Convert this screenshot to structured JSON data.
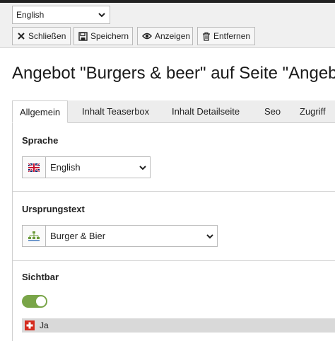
{
  "top": {
    "language_select": "English",
    "buttons": {
      "close": "Schließen",
      "save": "Speichern",
      "view": "Anzeigen",
      "delete": "Entfernen"
    }
  },
  "page_title": "Angebot \"Burgers & beer\" auf Seite \"Angebote",
  "tabs": [
    "Allgemein",
    "Inhalt Teaserbox",
    "Inhalt Detailseite",
    "Seo",
    "Zugriff"
  ],
  "fields": {
    "sprache": {
      "label": "Sprache",
      "value": "English",
      "icon": "uk-flag-icon"
    },
    "ursprungstext": {
      "label": "Ursprungstext",
      "value": "Burger & Bier",
      "icon": "sitemap-icon"
    },
    "sichtbar": {
      "label": "Sichtbar",
      "toggle_on": true,
      "status_text": "Ja",
      "status_icon": "swiss-flag-icon"
    }
  },
  "colors": {
    "toggle_on": "#79a548",
    "swiss_red": "#d52b1e",
    "header_bg": "#f0f0f0"
  }
}
